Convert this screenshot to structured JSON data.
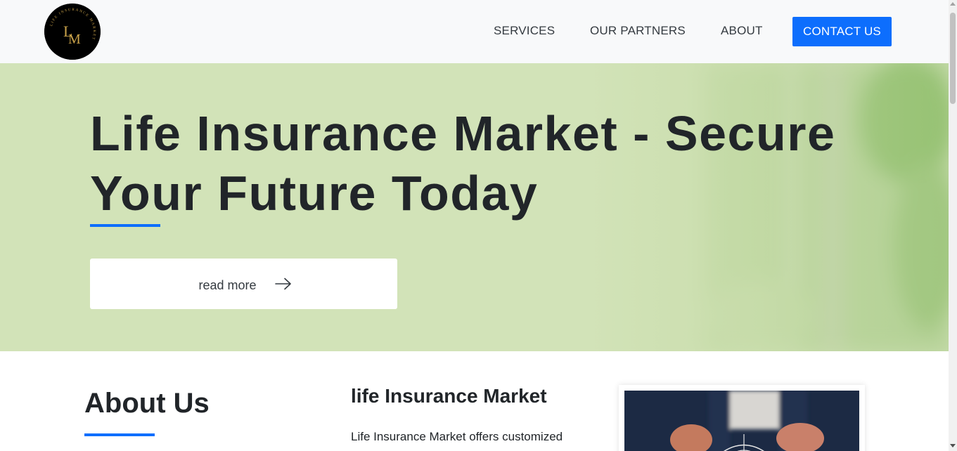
{
  "logo": {
    "initials_top": "L",
    "initials_bottom": "M",
    "ring_text": "LIFE INSURANCE MARKET",
    "icon": "logo-emblem",
    "gold": "#c9a24a"
  },
  "nav": {
    "services": "SERVICES",
    "partners": "OUR PARTNERS",
    "about": "ABOUT",
    "contact": "CONTACT US"
  },
  "hero": {
    "title": "Life Insurance Market - Secure Your Future Today",
    "read_more": "read more",
    "arrow_icon": "arrow-right-icon",
    "bg_color": "#d2e3b8",
    "accent": "#0d6efd"
  },
  "about": {
    "heading": "About Us",
    "subheading": "life Insurance Market",
    "text": "Life Insurance Market offers customized"
  },
  "colors": {
    "primary": "#0d6efd",
    "navbar_bg": "#f8f9fa",
    "text": "#212529"
  }
}
